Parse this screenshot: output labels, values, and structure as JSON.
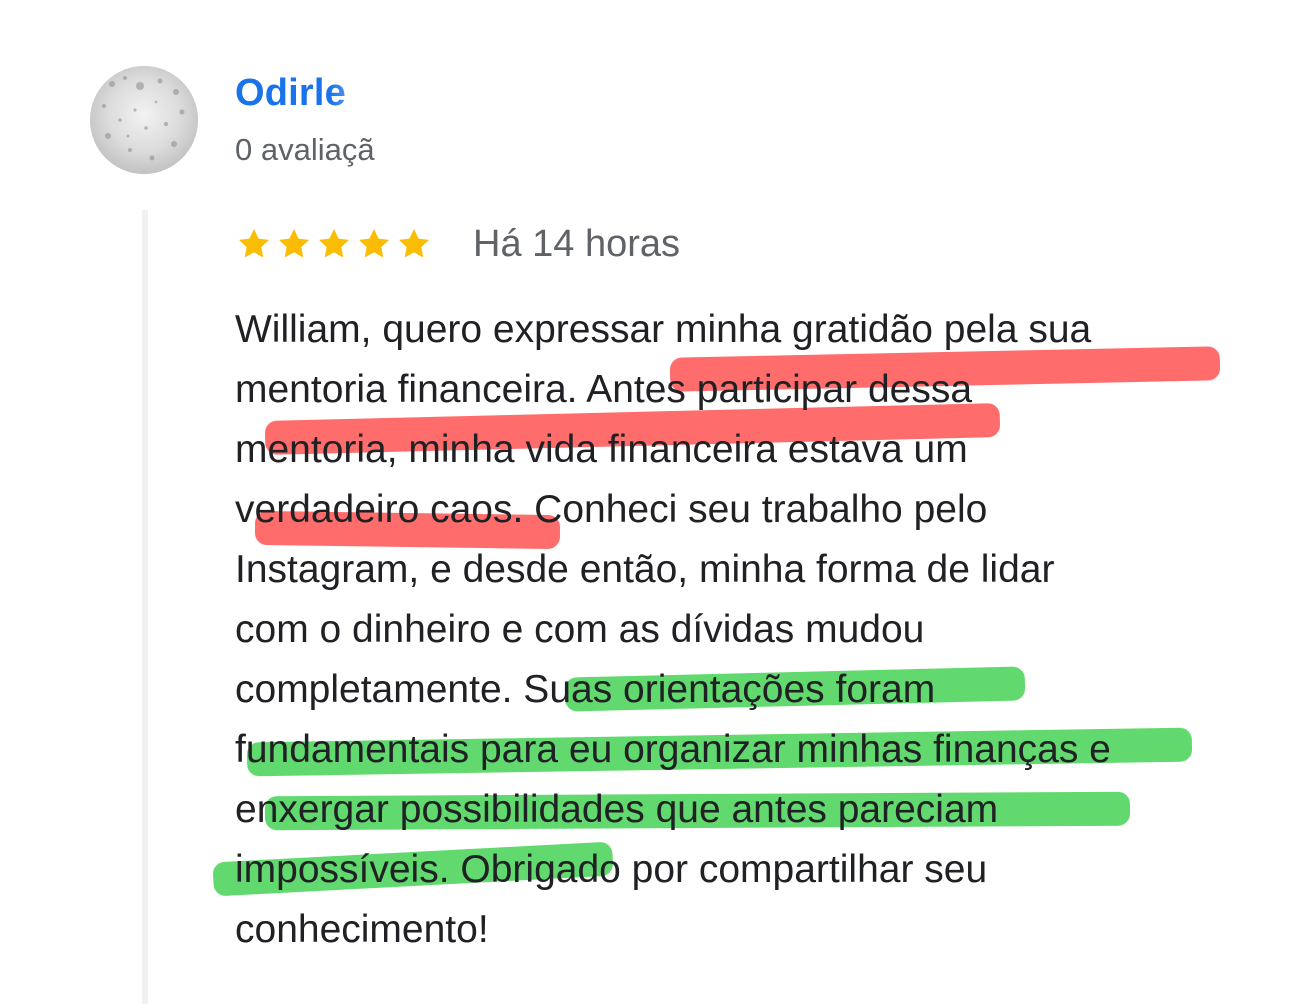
{
  "review": {
    "reviewer_name": "Odirle",
    "reviewer_meta": "0 avaliaçã",
    "avatar_icon": "avatar-photo",
    "rating": 5,
    "rating_max": 5,
    "time": "Há 14 horas",
    "lines": [
      "William, quero expressar minha gratidão pela sua",
      "mentoria financeira. Antes participar dessa",
      "mentoria, minha vida financeira estava um",
      "verdadeiro caos. Conheci seu trabalho pelo",
      "Instagram, e desde então, minha forma de lidar",
      "com o dinheiro e com as dívidas mudou",
      "completamente. Suas orientações foram",
      "fundamentais para eu organizar minhas finanças e",
      "enxergar possibilidades que antes pareciam",
      "impossíveis. Obrigado por compartilhar seu",
      "conhecimento!"
    ]
  },
  "colors": {
    "name": "#1a73e8",
    "star": "#fbbc04",
    "text": "#202124",
    "meta": "#5f6368",
    "highlight_red": "#ff5252",
    "highlight_green": "#3fd14e"
  }
}
